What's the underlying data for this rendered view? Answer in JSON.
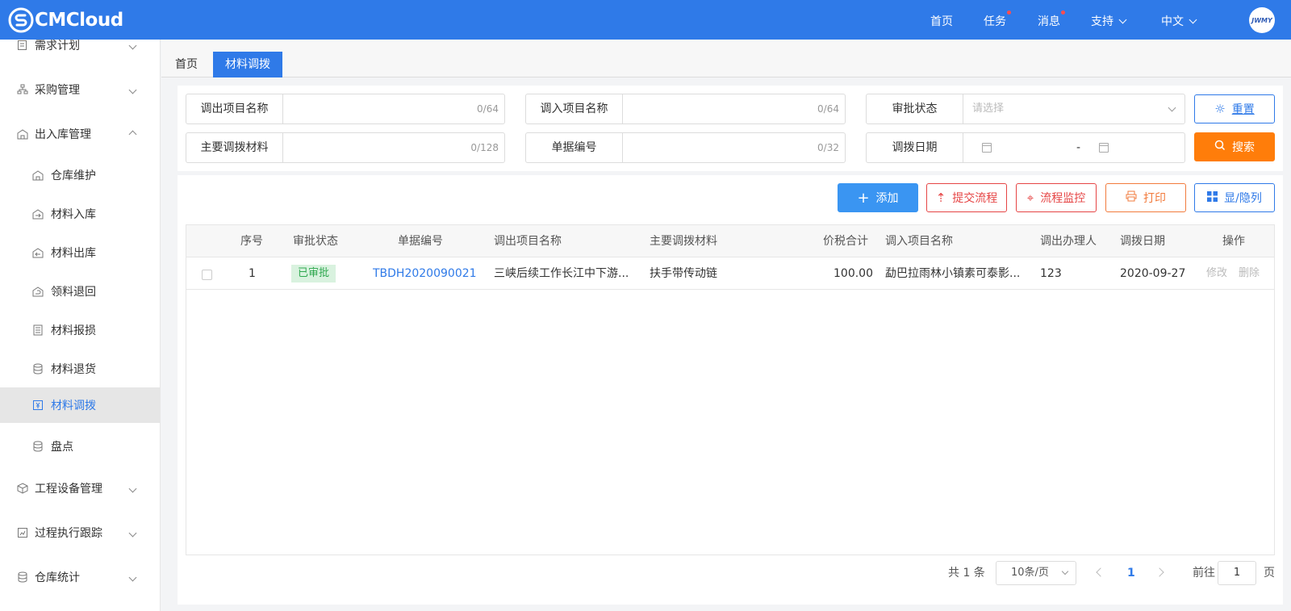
{
  "header": {
    "logo_text": "CMCloud",
    "avatar_text": "JWMY",
    "nav": [
      {
        "label": "首页",
        "dot": false
      },
      {
        "label": "任务",
        "dot": true
      },
      {
        "label": "消息",
        "dot": true
      },
      {
        "label": "支持",
        "dropdown": true
      },
      {
        "label": "中文",
        "dropdown": true
      }
    ]
  },
  "sidebar": {
    "items": [
      {
        "label": "需求计划",
        "icon": "clipboard-icon",
        "level": 1,
        "chevron": "down"
      },
      {
        "label": "采购管理",
        "icon": "sitemap-icon",
        "level": 1,
        "chevron": "down"
      },
      {
        "label": "出入库管理",
        "icon": "warehouse-icon",
        "level": 1,
        "chevron": "up"
      },
      {
        "label": "仓库维护",
        "icon": "warehouse-icon",
        "level": 2
      },
      {
        "label": "材料入库",
        "icon": "building-in-icon",
        "level": 2
      },
      {
        "label": "材料出库",
        "icon": "building-out-icon",
        "level": 2
      },
      {
        "label": "领料退回",
        "icon": "return-icon",
        "level": 2
      },
      {
        "label": "材料报损",
        "icon": "report-icon",
        "level": 2
      },
      {
        "label": "材料退货",
        "icon": "coins-icon",
        "level": 2
      },
      {
        "label": "材料调拨",
        "icon": "transfer-icon",
        "level": 2,
        "active": true
      },
      {
        "label": "盘点",
        "icon": "database-icon",
        "level": 2
      },
      {
        "label": "工程设备管理",
        "icon": "cube-icon",
        "level": 1,
        "chevron": "down"
      },
      {
        "label": "过程执行跟踪",
        "icon": "track-icon",
        "level": 1,
        "chevron": "down"
      },
      {
        "label": "仓库统计",
        "icon": "stats-icon",
        "level": 1,
        "chevron": "down"
      }
    ]
  },
  "tabs": [
    {
      "label": "首页",
      "active": false
    },
    {
      "label": "材料调拨",
      "active": true
    }
  ],
  "filters": {
    "out_project": {
      "label": "调出项目名称",
      "count": "0/64"
    },
    "in_project": {
      "label": "调入项目名称",
      "count": "0/64"
    },
    "approval": {
      "label": "审批状态",
      "placeholder": "请选择"
    },
    "material": {
      "label": "主要调拨材料",
      "count": "0/128"
    },
    "doc_no": {
      "label": "单据编号",
      "count": "0/32"
    },
    "date": {
      "label": "调拨日期",
      "separator": "-"
    },
    "reset_label": "重置",
    "search_label": "搜索"
  },
  "toolbar": {
    "add_label": "添加",
    "submit_label": "提交流程",
    "monitor_label": "流程监控",
    "print_label": "打印",
    "columns_label": "显/隐列"
  },
  "table": {
    "headers": [
      "序号",
      "审批状态",
      "单据编号",
      "调出项目名称",
      "主要调拨材料",
      "价税合计",
      "调入项目名称",
      "调出办理人",
      "调拨日期",
      "操作"
    ],
    "rows": [
      {
        "index": "1",
        "status": "已审批",
        "doc_no": "TBDH2020090021",
        "out_project": "三峡后续工作长江中下游...",
        "material": "扶手带传动链",
        "amount": "100.00",
        "in_project": "勐巴拉雨林小镇素可泰影...",
        "handler": "123",
        "date": "2020-09-27",
        "edit": "修改",
        "delete": "删除"
      }
    ]
  },
  "pagination": {
    "total_text": "共 1 条",
    "page_size": "10条/页",
    "current_page": "1",
    "goto_label": "前往",
    "goto_value": "1",
    "page_suffix": "页"
  },
  "colors": {
    "header_bg": "#2f7ae8",
    "search_btn": "#ff7d0a",
    "add_btn": "#3a95f2",
    "danger": "#e64545",
    "approved_bg": "#d9f2df"
  }
}
